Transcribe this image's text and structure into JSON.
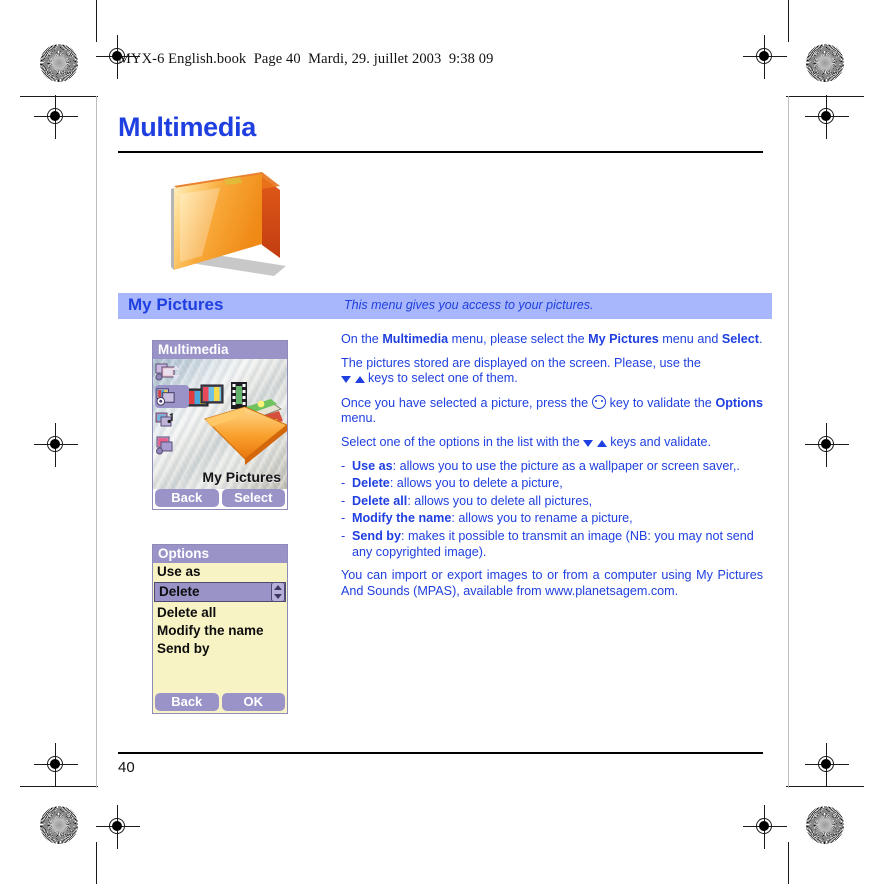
{
  "running_head": "MYX-6 English.book  Page 40  Mardi, 29. juillet 2003  9:38 09",
  "chapter": {
    "title": "Multimedia",
    "art_icon": "orange-folder-icon"
  },
  "section": {
    "title": "My Pictures",
    "description": "This menu gives you access to your pictures."
  },
  "screenshots": [
    {
      "name": "multimedia-browser",
      "titlebar": "Multimedia",
      "caption": "My Pictures",
      "thumbnails": [
        "pictures-thumb",
        "pictures-thumb-selected",
        "sounds-thumb",
        "animations-thumb"
      ],
      "softkeys": [
        "Back",
        "Select"
      ]
    },
    {
      "name": "options-menu",
      "titlebar": "Options",
      "items": [
        {
          "label": "Use as",
          "selected": false
        },
        {
          "label": "Delete",
          "selected": true
        },
        {
          "label": "Delete all",
          "selected": false
        },
        {
          "label": "Modify the name",
          "selected": false
        },
        {
          "label": "Send by",
          "selected": false
        }
      ],
      "softkeys": [
        "Back",
        "OK"
      ]
    }
  ],
  "body": {
    "p1_a": "On the ",
    "p1_b1": "Multimedia",
    "p1_b": " menu, please select the ",
    "p1_b2": "My Pictures",
    "p1_c": " menu and ",
    "p1_b3": "Select",
    "p1_d": ".",
    "p2_a": "The pictures stored are displayed on the screen. Please, use the",
    "p2_b": " keys to select one of them.",
    "p3_a": "Once you have selected a picture, press the",
    "p3_b": " key to validate the ",
    "p3_b1": "Options",
    "p3_c": " menu.",
    "p4_a": "Select one of the options in the list with the",
    "p4_b": " keys and validate.",
    "bullets": [
      {
        "dash": "-",
        "term": "Use as",
        "rest": ": allows you to use the picture as a wallpaper or screen saver,."
      },
      {
        "dash": "-",
        "term": "Delete",
        "rest": ": allows you to delete a picture,"
      },
      {
        "dash": "-",
        "term": "Delete all",
        "rest": ": allows you to delete all pictures,"
      },
      {
        "dash": "-",
        "term": "Modify the name",
        "rest": ": allows you to rename a picture,"
      },
      {
        "dash": "-",
        "term": "Send by",
        "rest": ": makes it possible to transmit an image (NB: you may not send any copyrighted image)."
      }
    ],
    "p5": "You can import or export images to or from a computer using My Pictures And Sounds (MPAS), available from www.planetsagem.com."
  },
  "footer": {
    "page_number": "40"
  },
  "colors": {
    "accent_blue": "#1f3fe0",
    "band_bg": "#a8b7fb",
    "phone_purple": "#9a93c8",
    "options_bg": "#f7f3c4",
    "folder_orange": "#f2922a"
  }
}
